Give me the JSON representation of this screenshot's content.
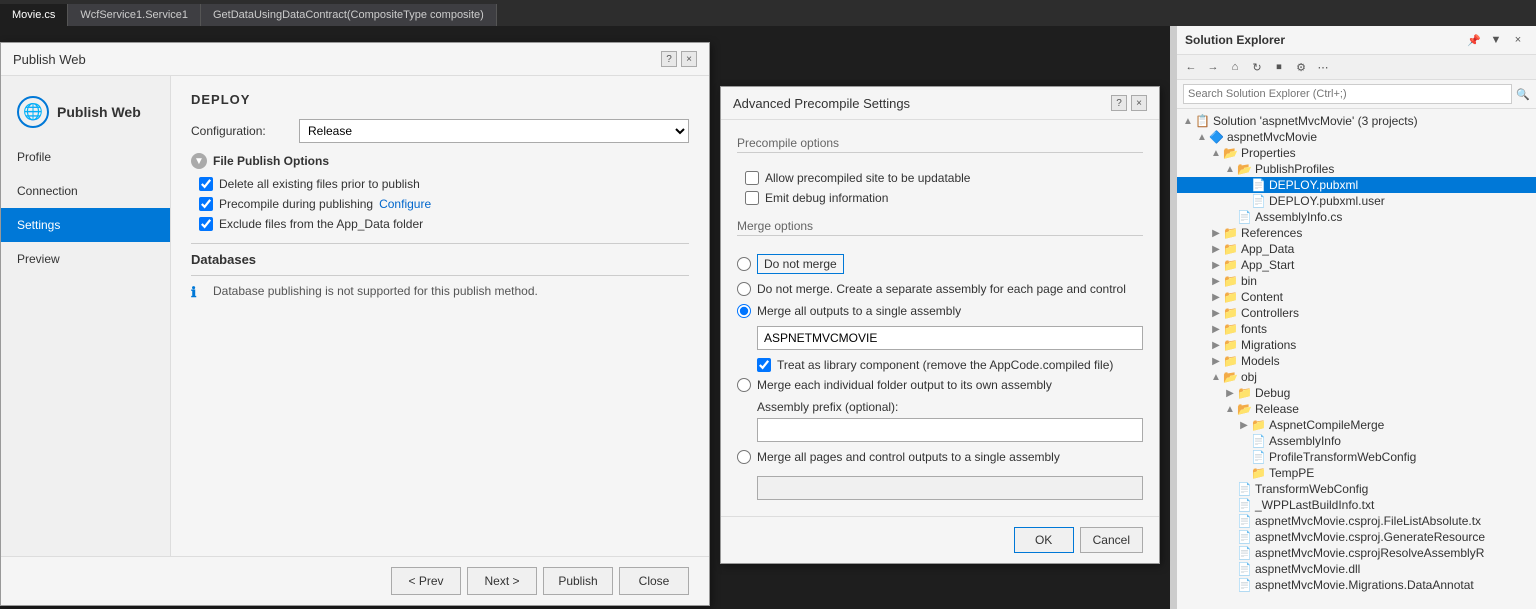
{
  "topTabs": [
    {
      "label": "Movie.cs",
      "active": true
    },
    {
      "label": "WcfService1.Service1",
      "active": false
    },
    {
      "label": "GetDataUsingDataContract(CompositeType composite)",
      "active": false
    }
  ],
  "publishDialog": {
    "title": "Publish Web",
    "helpBtn": "?",
    "closeBtn": "×",
    "navItems": [
      {
        "label": "Profile",
        "active": false
      },
      {
        "label": "Connection",
        "active": false
      },
      {
        "label": "Settings",
        "active": true
      },
      {
        "label": "Preview",
        "active": false
      }
    ],
    "deploySection": {
      "title": "DEPLOY",
      "configLabel": "Configuration:",
      "configValue": "Release",
      "filePublishOptions": {
        "title": "File Publish Options",
        "checkboxes": [
          {
            "label": "Delete all existing files prior to publish",
            "checked": true
          },
          {
            "label": "Precompile during publishing",
            "checked": true,
            "link": "Configure"
          },
          {
            "label": "Exclude files from the App_Data folder",
            "checked": true
          }
        ]
      },
      "databases": {
        "title": "Databases",
        "infoText": "Database publishing is not supported for this publish method."
      }
    },
    "footer": {
      "prevBtn": "< Prev",
      "nextBtn": "Next >",
      "publishBtn": "Publish",
      "closeBtn": "Close"
    }
  },
  "advancedDialog": {
    "title": "Advanced Precompile Settings",
    "helpBtn": "?",
    "closeBtn": "×",
    "precompileOptions": {
      "groupLabel": "Precompile options",
      "checkboxes": [
        {
          "label": "Allow precompiled site to be updatable",
          "checked": false
        },
        {
          "label": "Emit debug information",
          "checked": false
        }
      ]
    },
    "mergeOptions": {
      "groupLabel": "Merge options",
      "radios": [
        {
          "label": "Do not merge",
          "selected": false,
          "boxed": true
        },
        {
          "label": "Do not merge. Create a separate assembly for each page and control",
          "selected": false
        },
        {
          "label": "Merge all outputs to a single assembly",
          "selected": true
        }
      ],
      "assemblyName": "ASPNETMVCMOVIE",
      "treatAsLibrary": {
        "checked": true,
        "label": "Treat as library component (remove the AppCode.compiled file)"
      },
      "mergeEachFolder": {
        "label": "Merge each individual folder output to its own assembly",
        "selected": false
      },
      "assemblyPrefix": {
        "label": "Assembly prefix (optional):",
        "value": ""
      },
      "mergeAllPages": {
        "label": "Merge all pages and control outputs to a single assembly",
        "selected": false
      }
    },
    "okBtn": "OK",
    "cancelBtn": "Cancel"
  },
  "solutionExplorer": {
    "title": "Solution Explorer",
    "searchPlaceholder": "Search Solution Explorer (Ctrl+;)",
    "tree": {
      "solution": "Solution 'aspnetMvcMovie' (3 projects)",
      "project": "aspnetMvcMovie",
      "items": [
        {
          "label": "Properties",
          "indent": 2,
          "expanded": true,
          "icon": "📁"
        },
        {
          "label": "PublishProfiles",
          "indent": 3,
          "expanded": true,
          "icon": "📁"
        },
        {
          "label": "DEPLOY.pubxml",
          "indent": 4,
          "expanded": false,
          "icon": "📄",
          "selected": true
        },
        {
          "label": "DEPLOY.pubxml.user",
          "indent": 4,
          "expanded": false,
          "icon": "📄"
        },
        {
          "label": "AssemblyInfo.cs",
          "indent": 3,
          "expanded": false,
          "icon": "📄"
        },
        {
          "label": "References",
          "indent": 2,
          "expanded": false,
          "icon": "📁"
        },
        {
          "label": "App_Data",
          "indent": 2,
          "expanded": false,
          "icon": "📁"
        },
        {
          "label": "App_Start",
          "indent": 2,
          "expanded": false,
          "icon": "📁"
        },
        {
          "label": "bin",
          "indent": 2,
          "expanded": false,
          "icon": "📁"
        },
        {
          "label": "Content",
          "indent": 2,
          "expanded": false,
          "icon": "📁"
        },
        {
          "label": "Controllers",
          "indent": 2,
          "expanded": false,
          "icon": "📁"
        },
        {
          "label": "fonts",
          "indent": 2,
          "expanded": false,
          "icon": "📁"
        },
        {
          "label": "Migrations",
          "indent": 2,
          "expanded": false,
          "icon": "📁"
        },
        {
          "label": "Models",
          "indent": 2,
          "expanded": false,
          "icon": "📁"
        },
        {
          "label": "obj",
          "indent": 2,
          "expanded": true,
          "icon": "📁"
        },
        {
          "label": "Debug",
          "indent": 3,
          "expanded": false,
          "icon": "📁"
        },
        {
          "label": "Release",
          "indent": 3,
          "expanded": true,
          "icon": "📁"
        },
        {
          "label": "AspnetCompileMerge",
          "indent": 4,
          "expanded": false,
          "icon": "📁"
        },
        {
          "label": "AssemblyInfo",
          "indent": 4,
          "expanded": false,
          "icon": "📄"
        },
        {
          "label": "ProfileTransformWebConfig",
          "indent": 4,
          "expanded": false,
          "icon": "📄"
        },
        {
          "label": "TempPE",
          "indent": 4,
          "expanded": false,
          "icon": "📁"
        },
        {
          "label": "TransformWebConfig",
          "indent": 3,
          "expanded": false,
          "icon": "📄"
        },
        {
          "label": "_WPPLastBuildInfo.txt",
          "indent": 3,
          "expanded": false,
          "icon": "📄"
        },
        {
          "label": "aspnetMvcMovie.csproj.FileListAbsolute.tx",
          "indent": 3,
          "expanded": false,
          "icon": "📄"
        },
        {
          "label": "aspnetMvcMovie.csproj.GenerateResource",
          "indent": 3,
          "expanded": false,
          "icon": "📄"
        },
        {
          "label": "aspnetMvcMovie.csprojResolveAssemblyR",
          "indent": 3,
          "expanded": false,
          "icon": "📄"
        },
        {
          "label": "aspnetMvcMovie.dll",
          "indent": 3,
          "expanded": false,
          "icon": "📄"
        },
        {
          "label": "aspnetMvcMovie.Migrations.DataAnnotat",
          "indent": 3,
          "expanded": false,
          "icon": "📄"
        }
      ]
    }
  }
}
